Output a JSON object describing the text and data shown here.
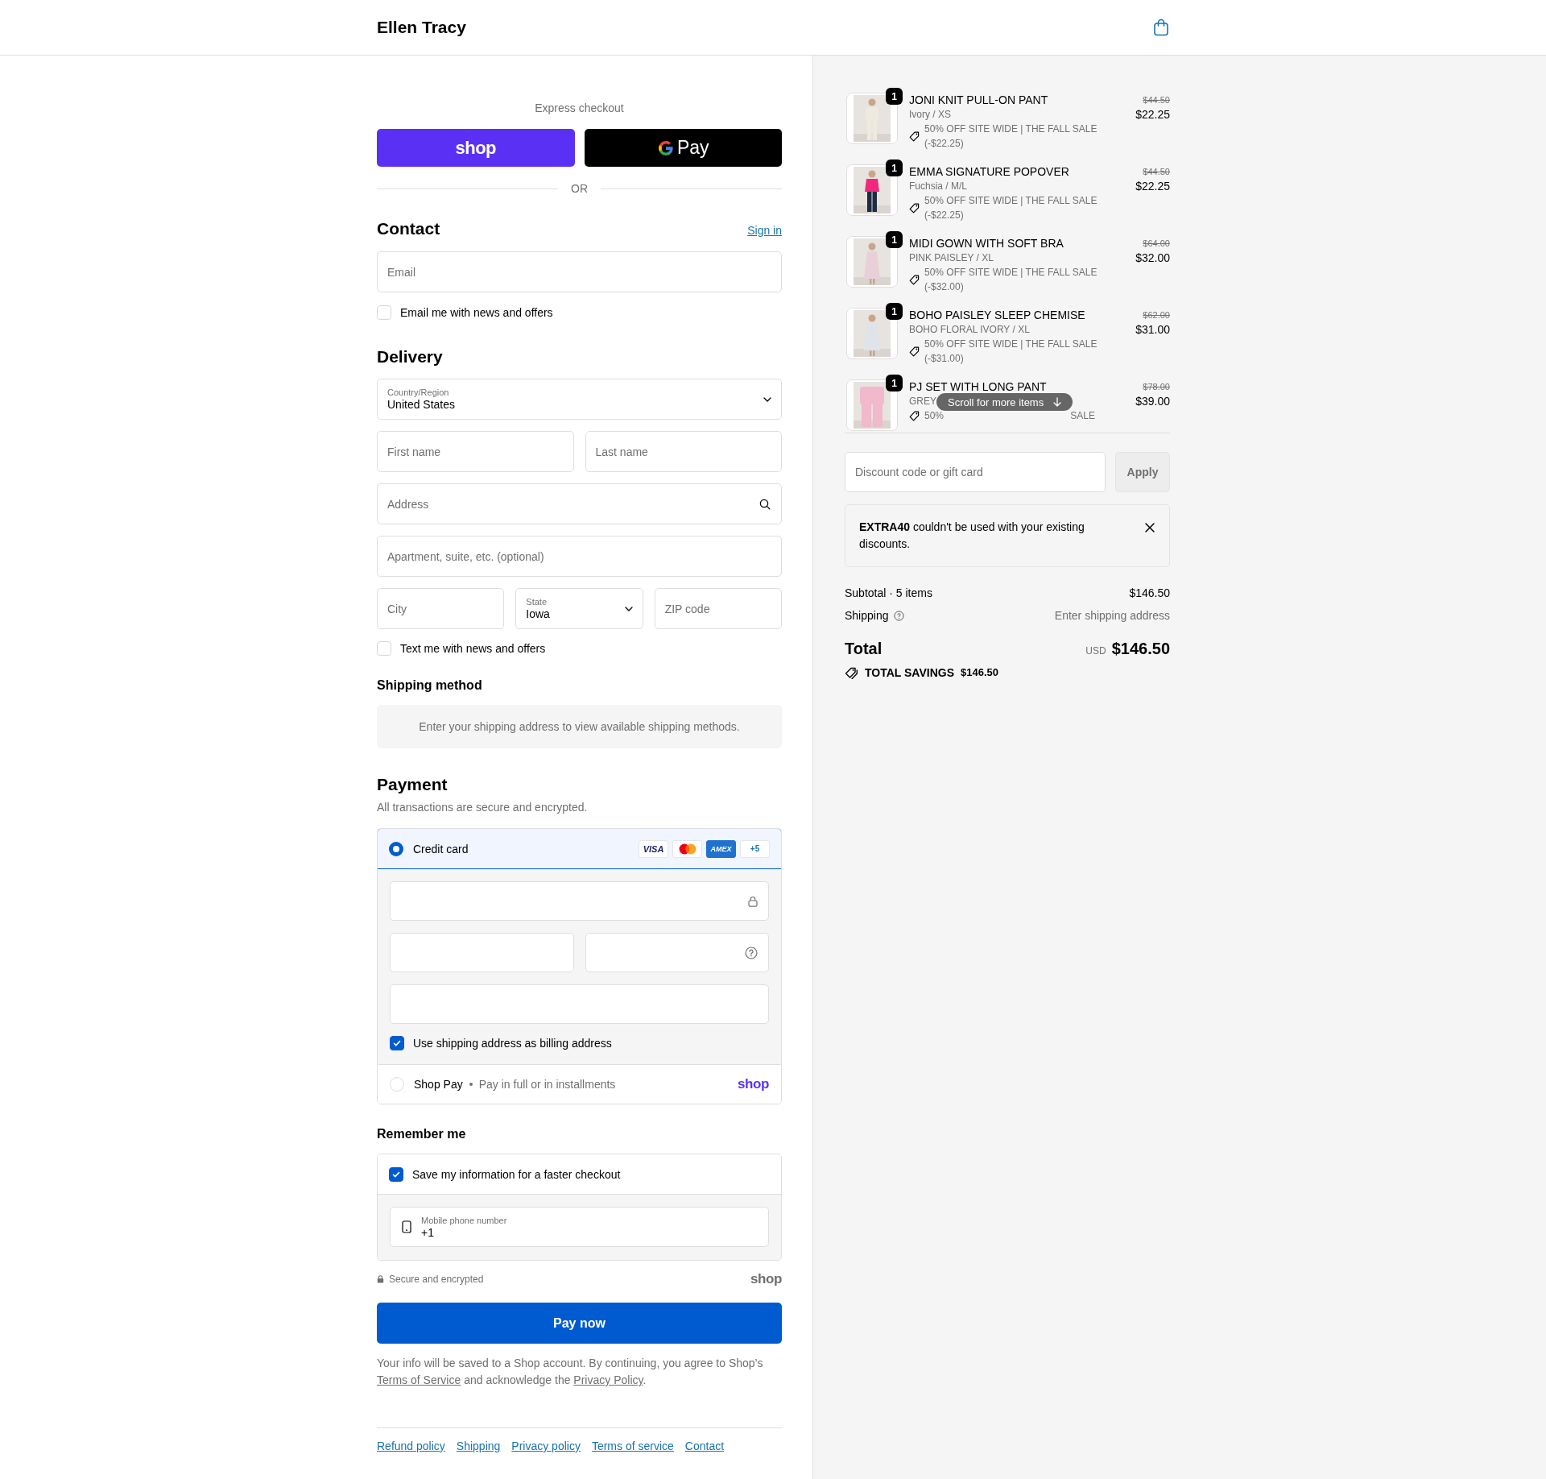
{
  "header": {
    "brand": "Ellen Tracy"
  },
  "express": {
    "label": "Express checkout",
    "shop_button": "shop",
    "gpay_button": "Pay",
    "divider": "OR"
  },
  "contact": {
    "title": "Contact",
    "sign_in": "Sign in",
    "email": {
      "placeholder": "Email"
    },
    "newsletter": {
      "label": "Email me with news and offers",
      "checked": false
    }
  },
  "delivery": {
    "title": "Delivery",
    "country": {
      "label": "Country/Region",
      "value": "United States"
    },
    "first_name": {
      "placeholder": "First name"
    },
    "last_name": {
      "placeholder": "Last name"
    },
    "address": {
      "placeholder": "Address"
    },
    "apartment": {
      "placeholder": "Apartment, suite, etc. (optional)"
    },
    "city": {
      "placeholder": "City"
    },
    "state": {
      "label": "State",
      "value": "Iowa"
    },
    "zip": {
      "placeholder": "ZIP code"
    },
    "sms": {
      "label": "Text me with news and offers",
      "checked": false
    }
  },
  "shipping_method": {
    "title": "Shipping method",
    "message": "Enter your shipping address to view available shipping methods."
  },
  "payment": {
    "title": "Payment",
    "subtitle": "All transactions are secure and encrypted.",
    "methods": [
      {
        "kind": "card",
        "label": "Credit card",
        "selected": true,
        "brands": [
          {
            "kind": "visa",
            "label": "VISA"
          },
          {
            "kind": "circles"
          },
          {
            "kind": "amex",
            "label": "AMEX"
          },
          {
            "kind": "more",
            "label": "+5"
          }
        ],
        "billing": {
          "label": "Use shipping address as billing address",
          "checked": true
        }
      },
      {
        "kind": "shop",
        "label": "Shop Pay",
        "note": "Pay in full or in installments",
        "logo": "shop",
        "selected": false
      }
    ]
  },
  "remember": {
    "title": "Remember me",
    "save": {
      "label": "Save my information for a faster checkout",
      "checked": true
    },
    "phone": {
      "label": "Mobile phone number",
      "value": "+1"
    }
  },
  "secure": {
    "label": "Secure and encrypted",
    "logo": "shop"
  },
  "pay_button": "Pay now",
  "legal": [
    {
      "kind": "text",
      "text": "Your info will be saved to a Shop account. By continuing, you agree to Shop’s "
    },
    {
      "kind": "link",
      "text": "Terms of Service"
    },
    {
      "kind": "text",
      "text": " and acknowledge the "
    },
    {
      "kind": "link",
      "text": "Privacy Policy"
    },
    {
      "kind": "text",
      "text": "."
    }
  ],
  "footer_links": [
    "Refund policy",
    "Shipping",
    "Privacy policy",
    "Terms of service",
    "Contact"
  ],
  "order": {
    "items": [
      {
        "quantity": "1",
        "name": "JONI KNIT PULL-ON PANT",
        "variant": "Ivory / XS",
        "discount": "50% OFF SITE WIDE | THE FALL SALE",
        "discount_amount": "(-$22.25)",
        "original_price": "$44.50",
        "price": "$22.25"
      },
      {
        "quantity": "1",
        "name": "EMMA SIGNATURE POPOVER",
        "variant": "Fuchsia / M/L",
        "discount": "50% OFF SITE WIDE | THE FALL SALE",
        "discount_amount": "(-$22.25)",
        "original_price": "$44.50",
        "price": "$22.25"
      },
      {
        "quantity": "1",
        "name": "MIDI GOWN WITH SOFT BRA",
        "variant": "PINK PAISLEY / XL",
        "discount": "50% OFF SITE WIDE | THE FALL SALE",
        "discount_amount": "(-$32.00)",
        "original_price": "$64.00",
        "price": "$32.00"
      },
      {
        "quantity": "1",
        "name": "BOHO PAISLEY SLEEP CHEMISE",
        "variant": "BOHO FLORAL IVORY / XL",
        "discount": "50% OFF SITE WIDE | THE FALL SALE",
        "discount_amount": "(-$31.00)",
        "original_price": "$62.00",
        "price": "$31.00"
      },
      {
        "quantity": "1",
        "name": "PJ SET WITH LONG PANT",
        "variant": "GREY",
        "discount_visible": [
          "50%",
          "SALE"
        ],
        "original_price": "$78.00",
        "price": "$39.00"
      }
    ],
    "scroll_hint": "Scroll for more items",
    "discount_field": {
      "placeholder": "Discount code or gift card"
    },
    "apply": {
      "label": "Apply",
      "disabled": true
    },
    "notice": "**EXTRA40** couldn't be used with your existing discounts.",
    "subtotal": {
      "label": "Subtotal · 5 items",
      "value": "$146.50"
    },
    "shipping": {
      "label": "Shipping",
      "value": "Enter shipping address"
    },
    "total": {
      "label": "Total",
      "currency": "USD",
      "value": "$146.50"
    },
    "savings": {
      "label": "TOTAL SAVINGS",
      "value": "$146.50"
    }
  }
}
